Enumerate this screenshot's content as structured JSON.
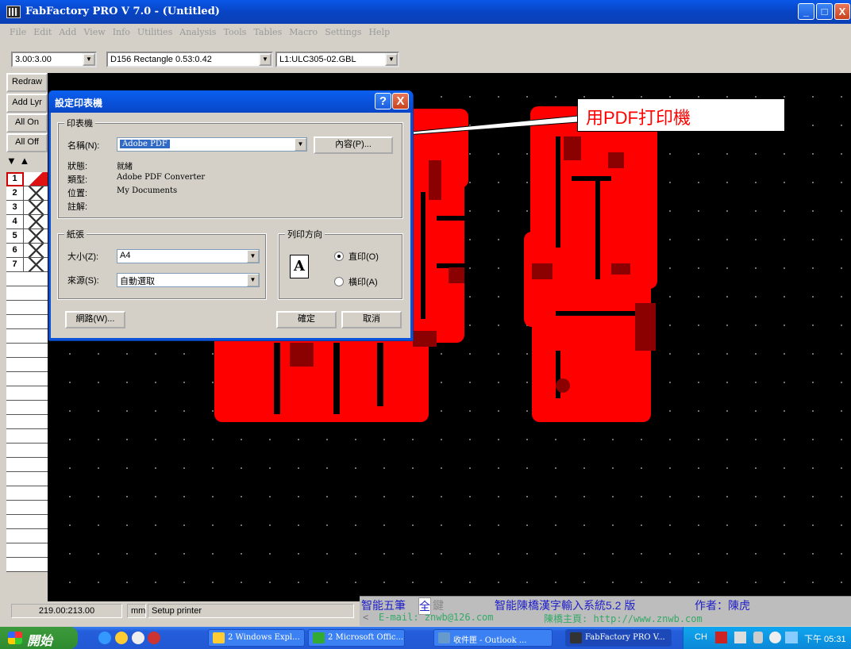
{
  "window": {
    "title": "FabFactory PRO V 7.0 - (Untitled)",
    "minimize": "_",
    "maximize": "□",
    "close": "X"
  },
  "menu": [
    "File",
    "Edit",
    "Add",
    "View",
    "Info",
    "Utilities",
    "Analysis",
    "Tools",
    "Tables",
    "Macro",
    "Settings",
    "Help"
  ],
  "toolbar": {
    "zoom": "3.00:3.00",
    "dcode": "D156  Rectangle 0.53:0.42",
    "layer": "L1:ULC305-02.GBL"
  },
  "left_panel": {
    "buttons": [
      "Redraw",
      "Add Lyr",
      "All On",
      "All Off"
    ],
    "layers": [
      "1",
      "2",
      "3",
      "4",
      "5",
      "6",
      "7"
    ]
  },
  "dialog": {
    "title": "設定印表機",
    "help": "?",
    "close": "X",
    "printer_group": "印表機",
    "name_label": "名稱(N):",
    "name_value": "Adobe PDF",
    "properties_button": "內容(P)...",
    "status_label": "狀態:",
    "status_value": "就緒",
    "type_label": "類型:",
    "type_value": "Adobe PDF Converter",
    "where_label": "位置:",
    "where_value": "My Documents",
    "comment_label": "註解:",
    "paper_group": "紙張",
    "size_label": "大小(Z):",
    "size_value": "A4",
    "source_label": "來源(S):",
    "source_value": "自動選取",
    "orientation_group": "列印方向",
    "portrait": "直印(O)",
    "landscape": "橫印(A)",
    "network_button": "網路(W)...",
    "ok_button": "確定",
    "cancel_button": "取消"
  },
  "callout": "用PDF打印機",
  "status": {
    "coords": "219.00:213.00",
    "units": "mm",
    "message": "Setup printer"
  },
  "ime": {
    "mode": "智能五筆",
    "full": "全",
    "key": "鍵",
    "system": "智能陳橋漢字輸入系統5.2 版",
    "author": "作者：陳虎",
    "email": "E-mail: znwb@126.com",
    "homepage": "陳橋主頁: http://www.znwb.com"
  },
  "taskbar": {
    "start": "開始",
    "tasks": [
      "2 Windows Expl...",
      "2 Microsoft Offic...",
      "收件匣 - Outlook ...",
      "FabFactory PRO V..."
    ],
    "tray_lang": "CH",
    "clock": "下午 05:31"
  },
  "colors": {
    "copper": "#ff0000",
    "canvas": "#000000",
    "xp_blue": "#0a58e8"
  }
}
